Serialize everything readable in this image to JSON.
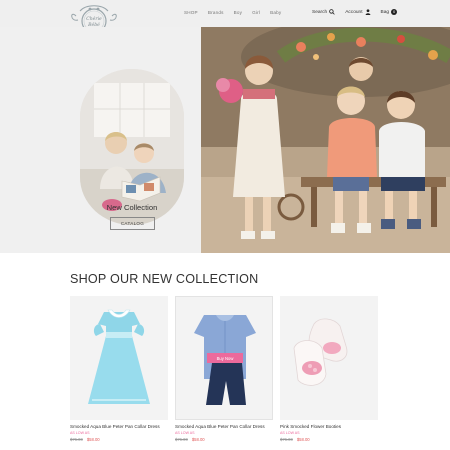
{
  "brand": {
    "logo_line1": "Chérie",
    "logo_line2": "Bébé"
  },
  "nav": [
    "SHOP",
    "Brands",
    "Boy",
    "Girl",
    "Baby"
  ],
  "header_tools": {
    "search_label": "Search",
    "account_label": "Account",
    "bag_label": "Bag",
    "bag_count": "0"
  },
  "hero": {
    "title": "New Collection",
    "button_label": "CATALOG"
  },
  "products_section": {
    "title": "SHOP OUR NEW COLLECTION",
    "buy_now_label": "Buy Now",
    "items": [
      {
        "name": "Smocked Aqua Blue Peter Pan Collar Dress",
        "sub": "AS LOW AS",
        "old_price": "$76.00",
        "new_price": "$58.00"
      },
      {
        "name": "Smocked Aqua Blue Peter Pan Collar Dress",
        "sub": "AS LOW AS",
        "old_price": "$76.00",
        "new_price": "$58.00"
      },
      {
        "name": "Pink Smocked Flower Booties",
        "sub": "AS LOW AS",
        "old_price": "$76.00",
        "new_price": "$58.00"
      }
    ]
  },
  "colors": {
    "accent_pink": "#ec6a9c",
    "price_red": "#e05a5a",
    "header_bg": "#efefef"
  }
}
